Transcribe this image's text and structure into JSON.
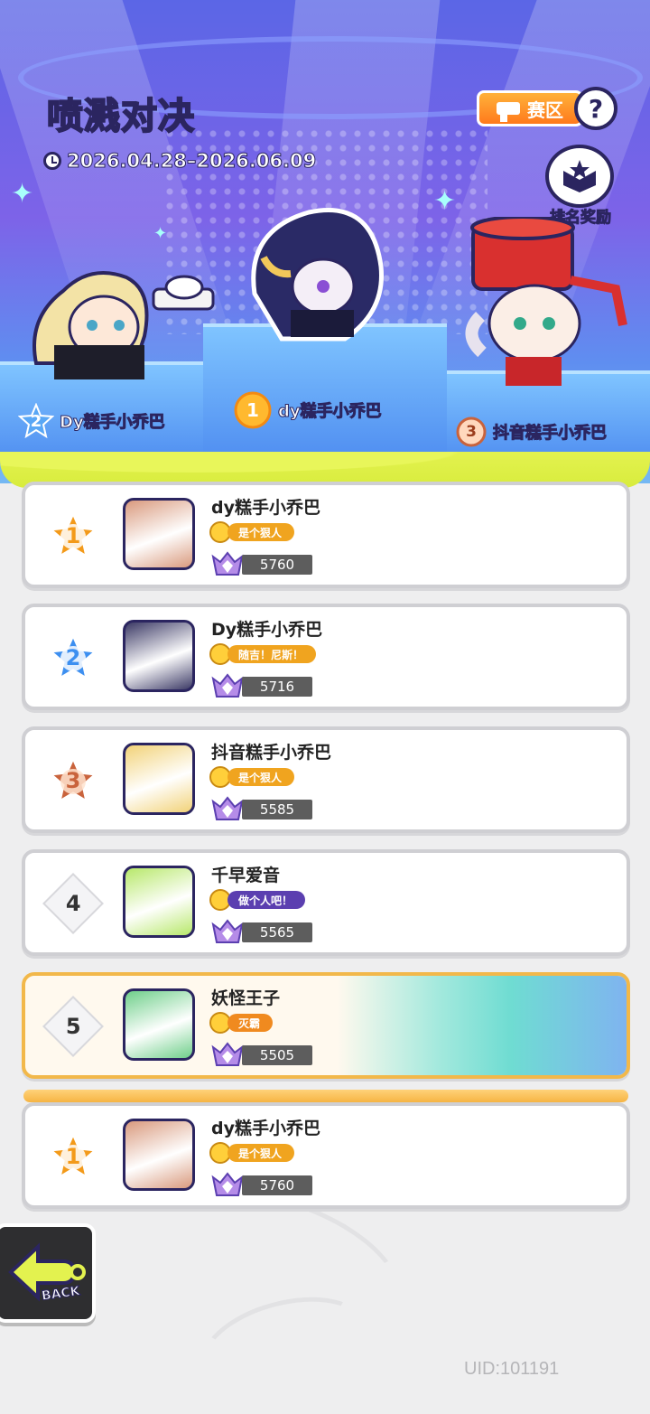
{
  "event": {
    "title_highlight": "喷溅",
    "title_rest": "对决",
    "date_range": "2026.04.28–2026.06.09"
  },
  "header_buttons": {
    "region_label": "赛区",
    "help_symbol": "?",
    "reward_label": "排名奖励"
  },
  "podium": [
    {
      "rank": "2",
      "name": "Dy糕手小乔巴"
    },
    {
      "rank": "1",
      "name": "dy糕手小乔巴"
    },
    {
      "rank": "3",
      "name": "抖音糕手小乔巴"
    }
  ],
  "leaderboard": [
    {
      "rank": "1",
      "name": "dy糕手小乔巴",
      "title": "是个狠人",
      "title_color": "#f0a41f",
      "score": "5760",
      "medal_color": "#f39a1a",
      "avatar_color": "#d99a7e"
    },
    {
      "rank": "2",
      "name": "Dy糕手小乔巴",
      "title": "随吉！尼斯！",
      "title_color": "#f0a41f",
      "score": "5716",
      "medal_color": "#3d8ff0",
      "avatar_color": "#3c3a66"
    },
    {
      "rank": "3",
      "name": "抖音糕手小乔巴",
      "title": "是个狠人",
      "title_color": "#f0a41f",
      "score": "5585",
      "medal_color": "#c9633c",
      "avatar_color": "#f2d278"
    },
    {
      "rank": "4",
      "name": "千早爱音",
      "title": "做个人吧！",
      "title_color": "#5b3fb0",
      "score": "5565",
      "medal_color": "#888888",
      "avatar_color": "#b7e86a"
    },
    {
      "rank": "5",
      "name": "妖怪王子",
      "title": "灭霸",
      "title_color": "#f08a1f",
      "score": "5505",
      "medal_color": "#888888",
      "avatar_color": "#6fcf8a"
    }
  ],
  "my_entry": {
    "rank": "1",
    "name": "dy糕手小乔巴",
    "title": "是个狠人",
    "title_color": "#f0a41f",
    "score": "5760",
    "medal_color": "#f39a1a",
    "avatar_color": "#d99a7e"
  },
  "back_label": "BACK",
  "uid": "UID:101191"
}
